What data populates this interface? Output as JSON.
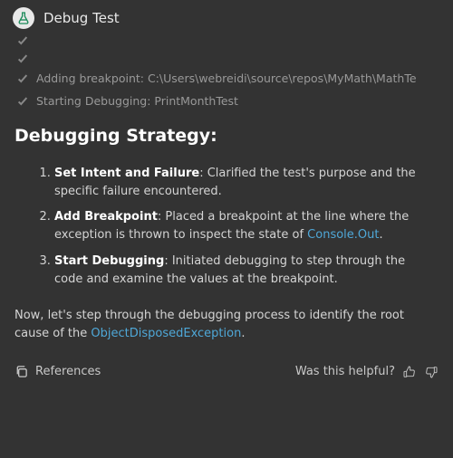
{
  "header": {
    "title": "Debug Test",
    "icon": "flask-icon"
  },
  "steps_log": [
    {
      "label": ""
    },
    {
      "label": ""
    },
    {
      "label": "Adding breakpoint: C:\\Users\\webreidi\\source\\repos\\MyMath\\MathTe"
    },
    {
      "label": "Starting Debugging: PrintMonthTest"
    }
  ],
  "strategy": {
    "heading": "Debugging Strategy:",
    "items": [
      {
        "title": "Set Intent and Failure",
        "body": ": Clarified the test's purpose and the specific failure encountered."
      },
      {
        "title": "Add Breakpoint",
        "body_pre": ": Placed a breakpoint at the line where the exception is thrown to inspect the state of ",
        "link": "Console.Out",
        "body_post": "."
      },
      {
        "title": "Start Debugging",
        "body": ": Initiated debugging to step through the code and examine the values at the breakpoint."
      }
    ]
  },
  "closing": {
    "pre": "Now, let's step through the debugging process to identify the root cause of the ",
    "link": "ObjectDisposedException",
    "post": "."
  },
  "footer": {
    "references_label": "References",
    "helpful_label": "Was this helpful?"
  }
}
